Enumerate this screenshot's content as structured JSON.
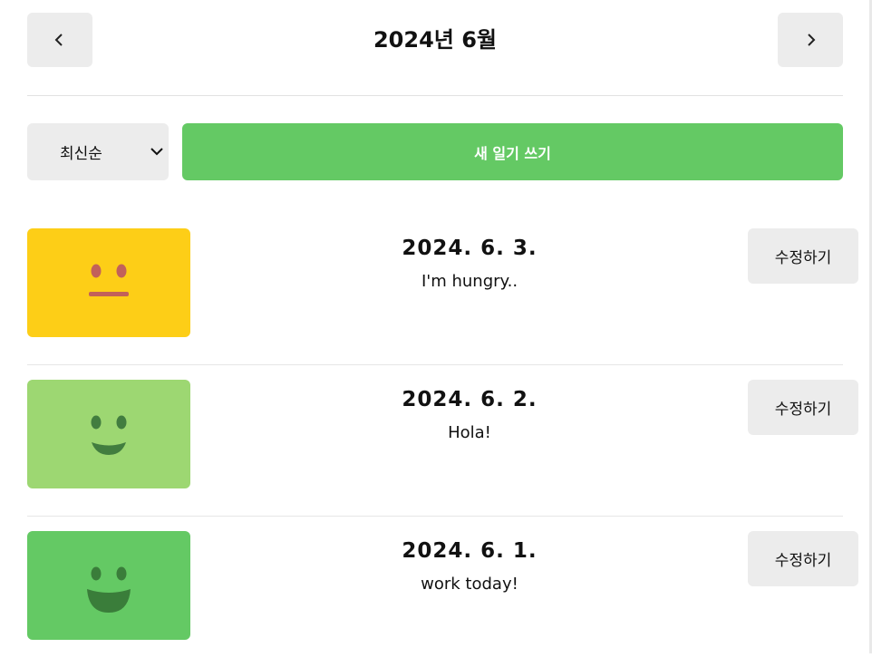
{
  "header": {
    "title": "2024년 6월",
    "prev_icon": "chevron-left-icon",
    "next_icon": "chevron-right-icon"
  },
  "toolbar": {
    "sort_selected": "최신순",
    "sort_icon": "chevron-down-icon",
    "new_button_label": "새 일기 쓰기",
    "accent_color": "#64c964"
  },
  "diary_items": [
    {
      "date": "2024. 6. 3.",
      "content": "I'm hungry..",
      "emotion_icon": "neutral-face-icon",
      "emotion_color": "#fdce17",
      "edit_label": "수정하기"
    },
    {
      "date": "2024. 6. 2.",
      "content": "Hola!",
      "emotion_icon": "smile-face-icon",
      "emotion_color": "#9dd772",
      "edit_label": "수정하기"
    },
    {
      "date": "2024. 6. 1.",
      "content": "work today!",
      "emotion_icon": "happy-face-icon",
      "emotion_color": "#64c964",
      "edit_label": "수정하기"
    }
  ]
}
